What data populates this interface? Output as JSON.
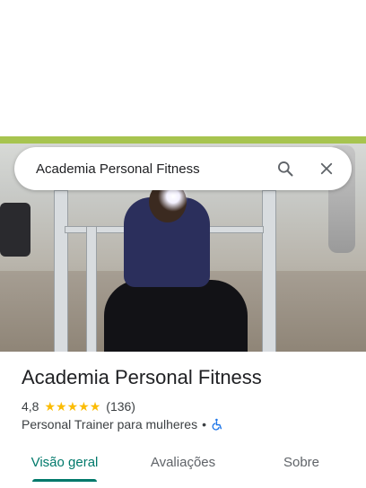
{
  "search": {
    "query": "Academia Personal Fitness"
  },
  "hero_photo": {
    "icon": "gym-photo"
  },
  "place": {
    "title": "Academia Personal Fitness",
    "rating": "4,8",
    "stars": 5,
    "reviews": "(136)",
    "category": "Personal Trainer para mulheres",
    "separator": "•"
  },
  "tabs": [
    {
      "label": "Visão geral",
      "active": true
    },
    {
      "label": "Avaliações",
      "active": false
    },
    {
      "label": "Sobre",
      "active": false
    }
  ],
  "colors": {
    "accent": "#00796b",
    "star": "#fbbc04",
    "accessibility": "#1a73e8"
  }
}
